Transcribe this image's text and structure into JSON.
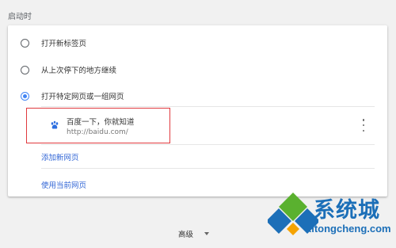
{
  "section_title": "启动时",
  "startup_options": [
    {
      "label": "打开新标签页",
      "checked": false
    },
    {
      "label": "从上次停下的地方继续",
      "checked": false
    },
    {
      "label": "打开特定网页或一组网页",
      "checked": true
    }
  ],
  "pages": [
    {
      "title": "百度一下，你就知道",
      "url": "http://baidu.com/",
      "icon": "baidu-paw-icon"
    }
  ],
  "links": {
    "add_page": "添加新网页",
    "use_current": "使用当前网页"
  },
  "advanced_label": "高级",
  "watermark": {
    "text": "系统城",
    "url": "xitongcheng.com"
  },
  "colors": {
    "accent": "#4285f4",
    "link": "#3367d6",
    "highlight": "#e0393e",
    "watermark": "#1c6fb8"
  }
}
